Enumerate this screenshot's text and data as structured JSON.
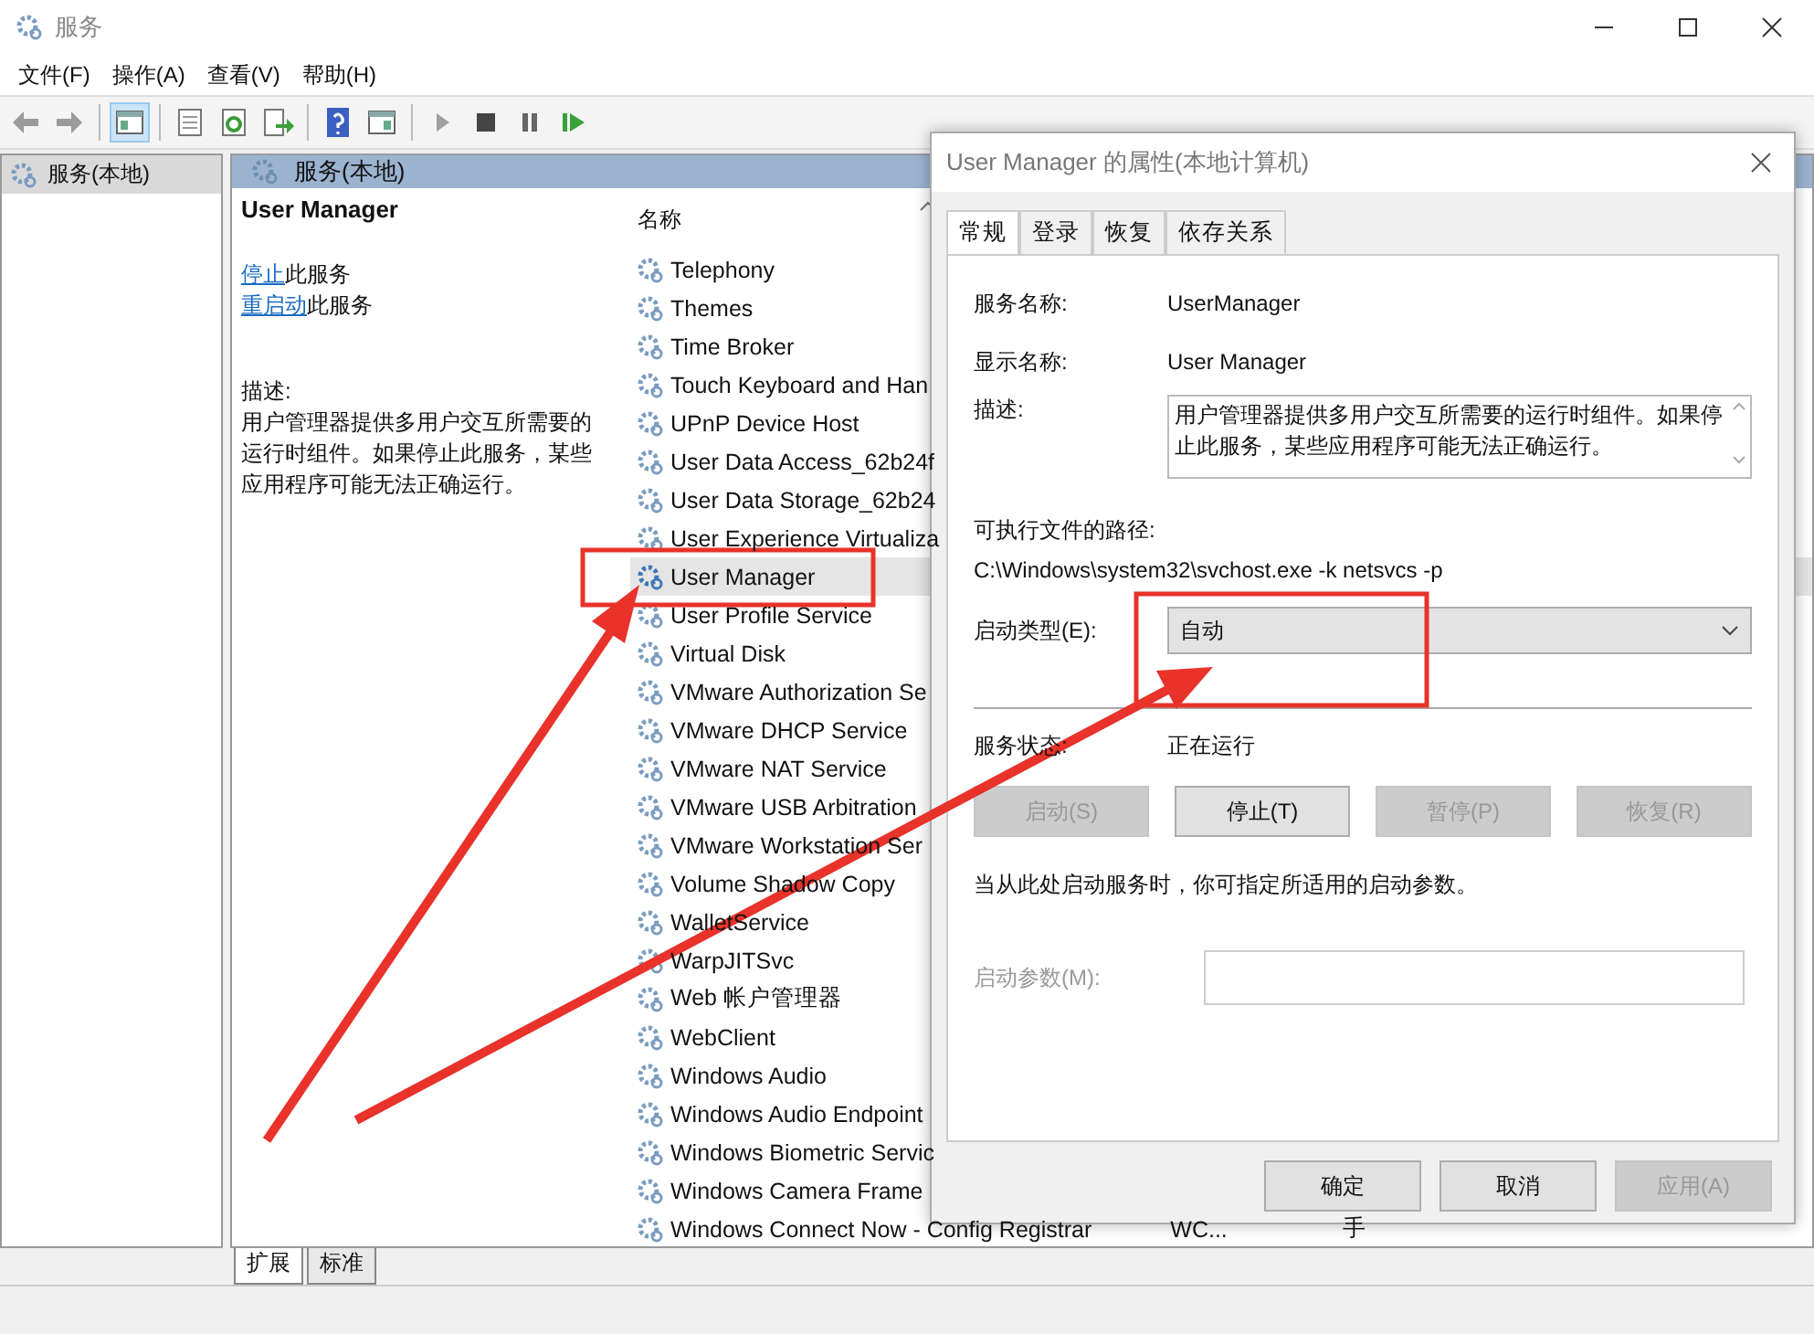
{
  "window": {
    "title": "服务"
  },
  "menu": [
    "文件(F)",
    "操作(A)",
    "查看(V)",
    "帮助(H)"
  ],
  "toolbar": [
    {
      "kind": "back",
      "disabled": true
    },
    {
      "kind": "forward",
      "disabled": true
    },
    {
      "kind": "sep"
    },
    {
      "kind": "tree",
      "pressed": true
    },
    {
      "kind": "sep"
    },
    {
      "kind": "properties"
    },
    {
      "kind": "refresh"
    },
    {
      "kind": "export"
    },
    {
      "kind": "sep"
    },
    {
      "kind": "help"
    },
    {
      "kind": "panel"
    },
    {
      "kind": "sep"
    },
    {
      "kind": "play",
      "disabled": true
    },
    {
      "kind": "stop"
    },
    {
      "kind": "pause"
    },
    {
      "kind": "resume"
    }
  ],
  "tree": [
    {
      "label": "服务(本地)",
      "selected": true
    }
  ],
  "panel": {
    "header": "服务(本地)",
    "service_name": "User Manager",
    "actions": [
      {
        "link": "停止",
        "text": "此服务"
      },
      {
        "link": "重启动",
        "text": "此服务"
      }
    ],
    "description_label": "描述:",
    "description": "用户管理器提供多用户交互所需要的运行时组件。如果停止此服务，某些应用程序可能无法正确运行。"
  },
  "list": {
    "columns": [
      "名称"
    ],
    "rows": [
      {
        "name": "Telephony",
        "selected": false
      },
      {
        "name": "Themes",
        "selected": false
      },
      {
        "name": "Time Broker",
        "selected": false
      },
      {
        "name": "Touch Keyboard and Han",
        "selected": false
      },
      {
        "name": "UPnP Device Host",
        "selected": false
      },
      {
        "name": "User Data Access_62b24f",
        "selected": false
      },
      {
        "name": "User Data Storage_62b24",
        "selected": false
      },
      {
        "name": "User Experience Virtualiza",
        "selected": false
      },
      {
        "name": "User Manager",
        "selected": true
      },
      {
        "name": "User Profile Service",
        "selected": false
      },
      {
        "name": "Virtual Disk",
        "selected": false
      },
      {
        "name": "VMware Authorization Se",
        "selected": false
      },
      {
        "name": "VMware DHCP Service",
        "selected": false
      },
      {
        "name": "VMware NAT Service",
        "selected": false
      },
      {
        "name": "VMware USB Arbitration",
        "selected": false
      },
      {
        "name": "VMware Workstation Ser",
        "selected": false
      },
      {
        "name": "Volume Shadow Copy",
        "selected": false
      },
      {
        "name": "WalletService",
        "selected": false
      },
      {
        "name": "WarpJITSvc",
        "selected": false
      },
      {
        "name": "Web 帐户管理器",
        "selected": false
      },
      {
        "name": "WebClient",
        "selected": false
      },
      {
        "name": "Windows Audio",
        "selected": false
      },
      {
        "name": "Windows Audio Endpoint",
        "selected": false
      },
      {
        "name": "Windows Biometric Servic",
        "selected": false
      },
      {
        "name": "Windows Camera Frame",
        "selected": false
      },
      {
        "name": "Windows Connect Now - Config Registrar",
        "selected": false,
        "column_2": "WC...",
        "column_3": "手"
      }
    ]
  },
  "bottom_tabs": [
    {
      "label": "扩展",
      "selected": true
    },
    {
      "label": "标准",
      "selected": false
    }
  ],
  "dialog": {
    "title": "User Manager 的属性(本地计算机)",
    "tabs": [
      {
        "label": "常规",
        "selected": true
      },
      {
        "label": "登录",
        "selected": false
      },
      {
        "label": "恢复",
        "selected": false
      },
      {
        "label": "依存关系",
        "selected": false
      }
    ],
    "service_name_label": "服务名称:",
    "service_name": "UserManager",
    "display_name_label": "显示名称:",
    "display_name": "User Manager",
    "description_label": "描述:",
    "description": "用户管理器提供多用户交互所需要的运行时组件。如果停止此服务，某些应用程序可能无法正确运行。",
    "path_label": "可执行文件的路径:",
    "path": "C:\\Windows\\system32\\svchost.exe -k netsvcs -p",
    "startup_label": "启动类型(E):",
    "startup": "自动",
    "status_label": "服务状态:",
    "status": "正在运行",
    "service_buttons": [
      {
        "label": "启动(S)",
        "disabled": true
      },
      {
        "label": "停止(T)",
        "disabled": false
      },
      {
        "label": "暂停(P)",
        "disabled": true
      },
      {
        "label": "恢复(R)",
        "disabled": true
      }
    ],
    "hint": "当从此处启动服务时，你可指定所适用的启动参数。",
    "params_label": "启动参数(M):",
    "params_disabled": true,
    "buttons": [
      {
        "label": "确定",
        "disabled": false
      },
      {
        "label": "取消",
        "disabled": false
      },
      {
        "label": "应用(A)",
        "disabled": true
      }
    ]
  }
}
